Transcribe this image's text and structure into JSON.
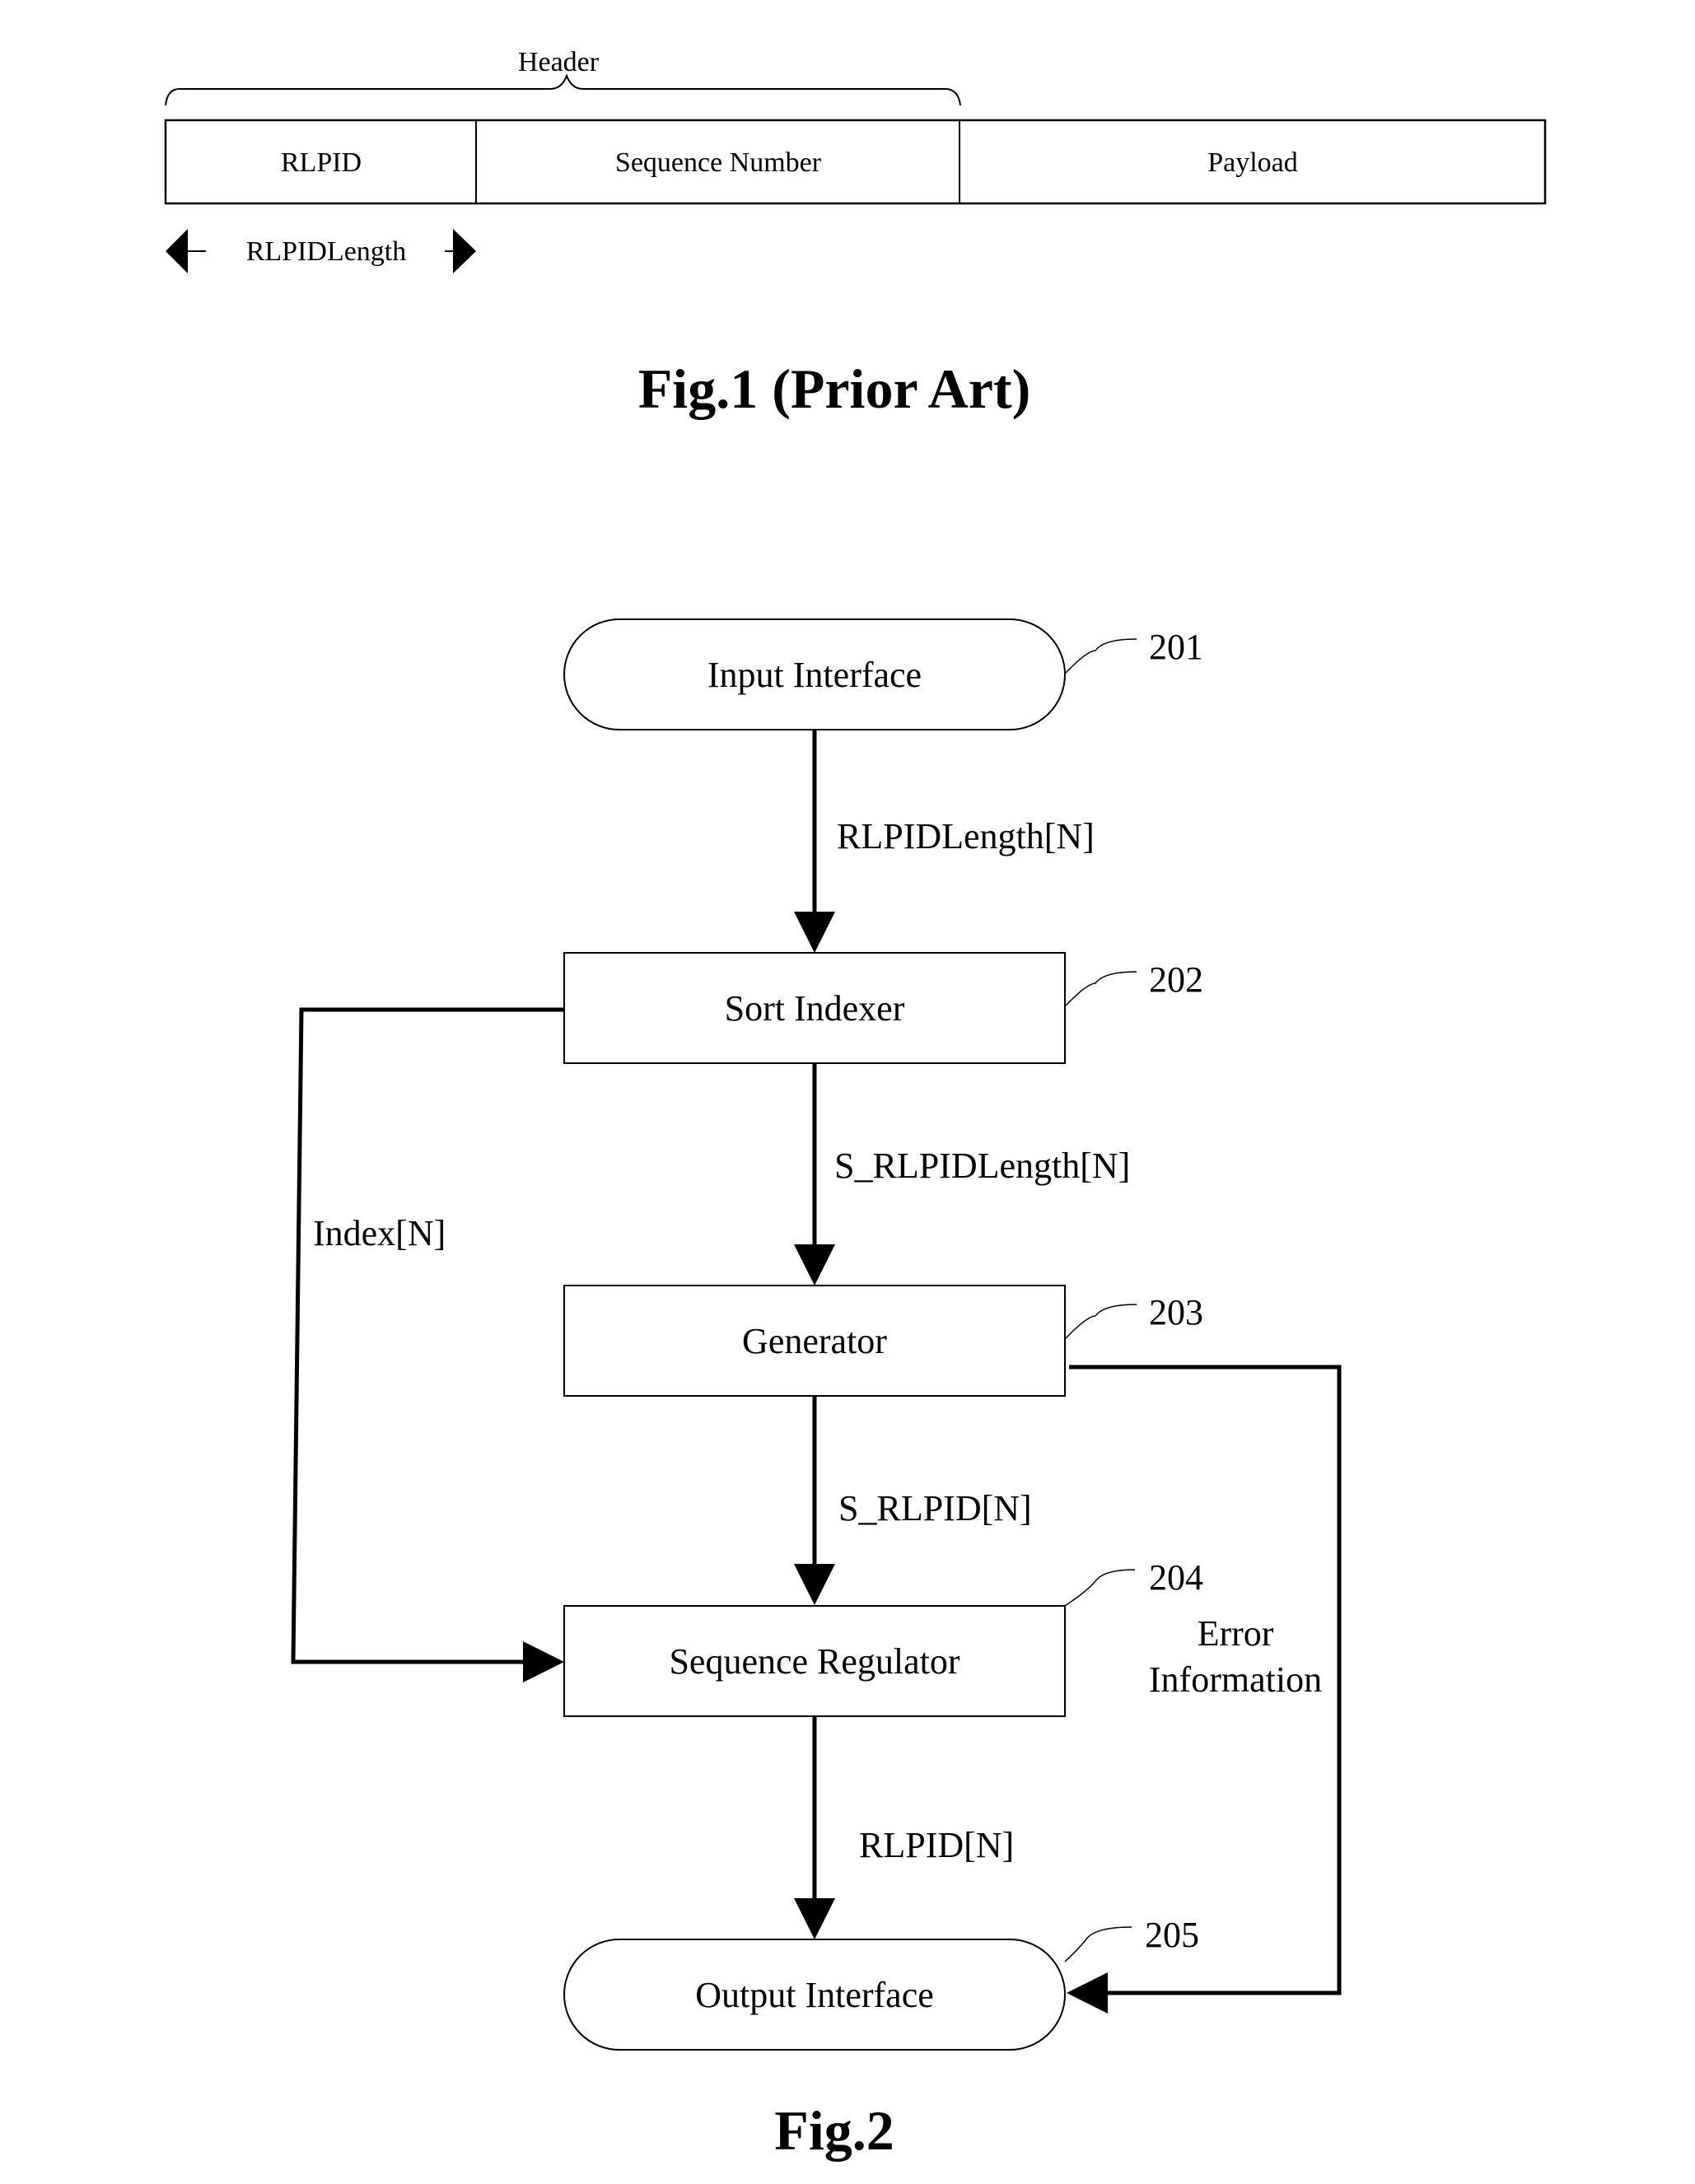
{
  "fig1": {
    "header_label": "Header",
    "cells": [
      "RLPID",
      "Sequence Number",
      "Payload"
    ],
    "length_label": "RLPIDLength",
    "caption": "Fig.1 (Prior Art)"
  },
  "fig2": {
    "nodes": {
      "input": {
        "label": "Input Interface",
        "ref": "201"
      },
      "sort": {
        "label": "Sort Indexer",
        "ref": "202"
      },
      "generator": {
        "label": "Generator",
        "ref": "203"
      },
      "regulator": {
        "label": "Sequence Regulator",
        "ref": "204"
      },
      "output": {
        "label": "Output Interface",
        "ref": "205"
      }
    },
    "edges": {
      "input_to_sort": "RLPIDLength[N]",
      "sort_to_generator": "S_RLPIDLength[N]",
      "generator_to_regulator": "S_RLPID[N]",
      "regulator_to_output": "RLPID[N]",
      "index": "Index[N]",
      "error_line1": "Error",
      "error_line2": "Information"
    },
    "caption": "Fig.2"
  }
}
